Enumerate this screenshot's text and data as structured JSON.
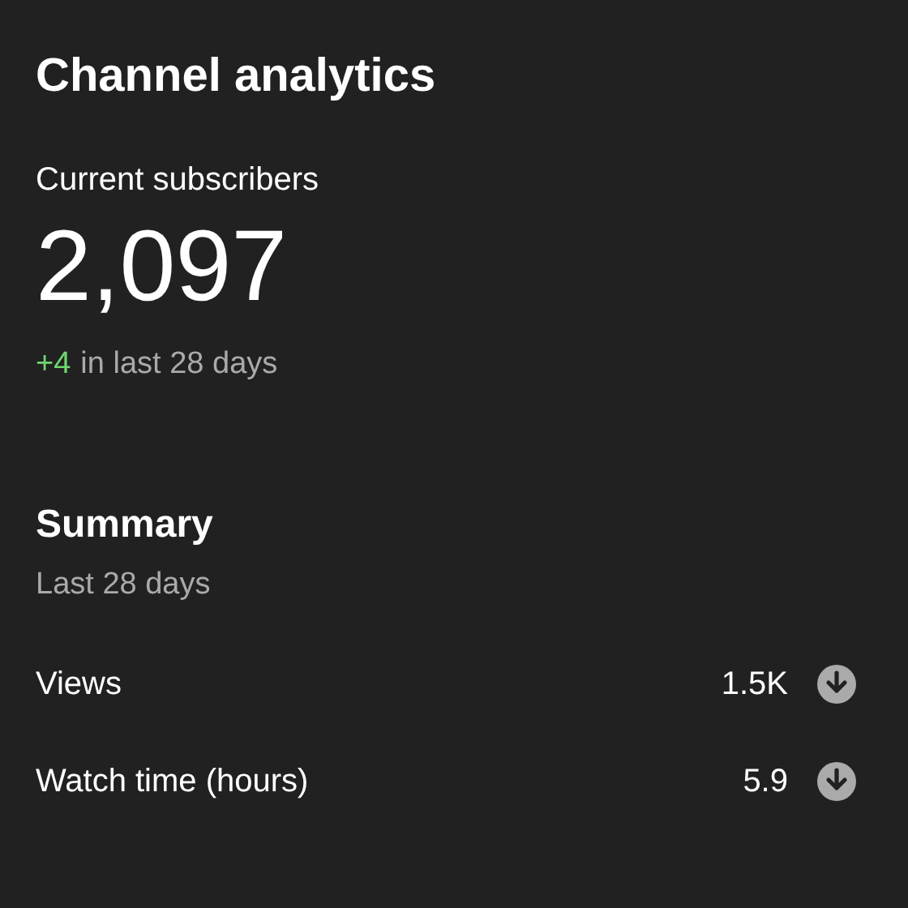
{
  "title": "Channel analytics",
  "subscribers": {
    "label": "Current subscribers",
    "value": "2,097",
    "change": "+4",
    "change_period": "in last 28 days"
  },
  "summary": {
    "title": "Summary",
    "period": "Last 28 days",
    "metrics": [
      {
        "label": "Views",
        "value": "1.5K",
        "kind": "decrease"
      },
      {
        "label": "Watch time (hours)",
        "value": "5.9",
        "kind": "decrease"
      }
    ]
  }
}
